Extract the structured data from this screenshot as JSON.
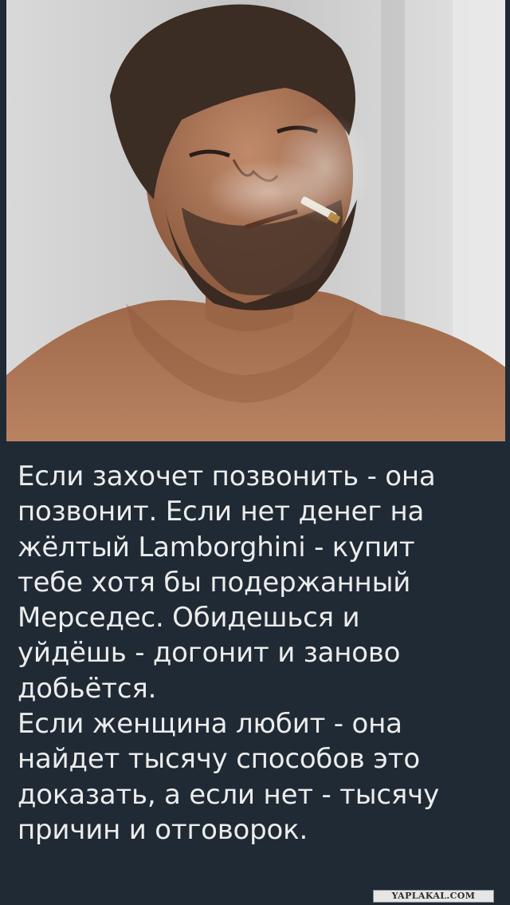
{
  "post": {
    "photo_subject": "man-smoking-photo",
    "caption": "Если захочет позвонить - она\nпозвонит.  Если нет денег на\nжёлтый Lamborghini - купит\nтебе хотя бы подержанный\nМерседес.  Обидешься и\nуйдёшь - догонит и заново\nдобьётся.\nЕсли женщина любит - она\nнайдет  тысячу способов это\nдоказать,  а если нет - тысячу\nпричин и отговорок.",
    "watermark": "YAPLAKAL.COM"
  },
  "colors": {
    "background": "#1f2a35",
    "caption_text": "#ececec",
    "watermark_bg": "#e6e6e6"
  }
}
